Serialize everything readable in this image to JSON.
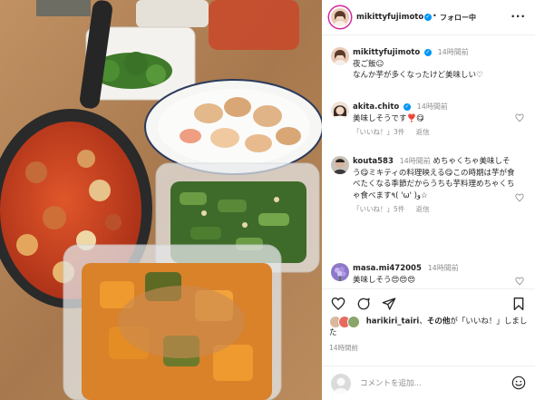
{
  "header": {
    "username": "mikittyfujimoto",
    "follow_label": "フォロー中",
    "more_label": "..."
  },
  "caption": {
    "username": "mikittyfujimoto",
    "time": "14時間前",
    "line1": "夜ご飯☺︎",
    "line2": "なんか芋が多くなったけど美味しい♡"
  },
  "comments": [
    {
      "username": "akita.chito",
      "time": "14時間前",
      "text": "美味しそうです❣️😋",
      "likes_label": "「いいね！」3件",
      "reply_label": "返信"
    },
    {
      "username": "kouta583",
      "time": "14時間前",
      "text": "めちゃくちゃ美味しそう😋ミキティの料理映える😋この時期は芋が食べたくなる季節だからうちも芋料理めちゃくちゃ食べます٩( 'ω' )و☆",
      "likes_label": "「いいね！」5件",
      "reply_label": "返信"
    },
    {
      "username": "masa.mi472005",
      "time": "14時間前",
      "text": "美味しそう😍😍😍"
    }
  ],
  "likes": {
    "text_bold1": "harikiri_tairi",
    "text_mid": "、",
    "text_bold2": "その他",
    "text_end": "が「いいね！」しました"
  },
  "post_time": "14時間前",
  "comment_input": {
    "placeholder": "コメントを追加..."
  },
  "colors": {
    "accent": "#0095f6",
    "story_ring": "#d6249f",
    "muted": "#8e8e8e"
  }
}
